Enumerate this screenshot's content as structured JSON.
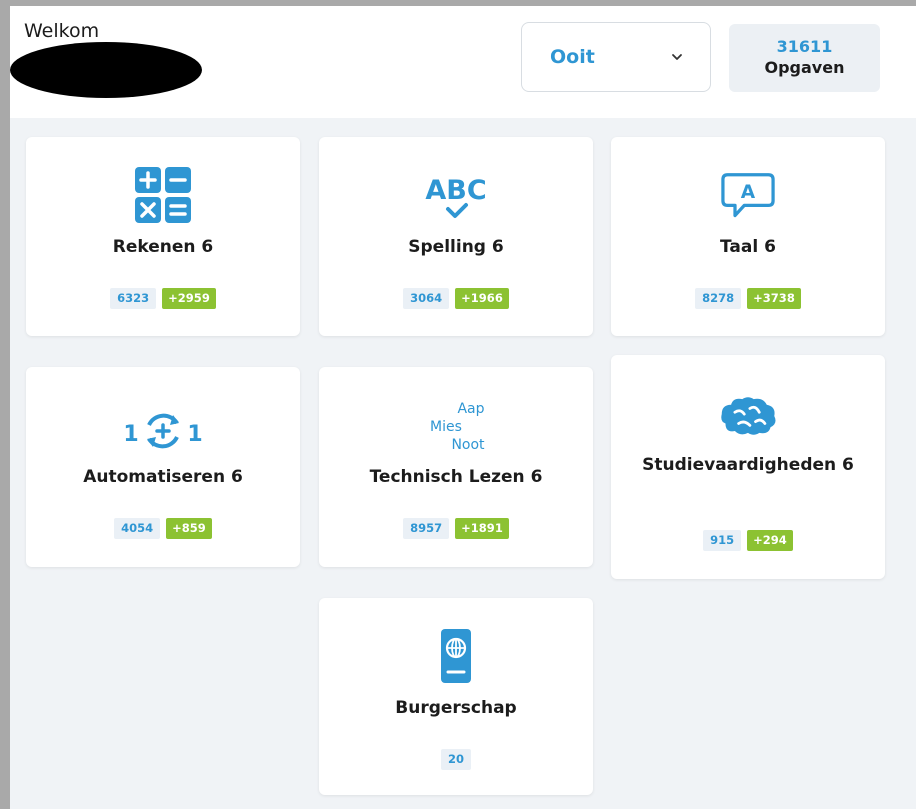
{
  "header": {
    "welcome": "Welkom",
    "period_select": {
      "value": "Ooit"
    },
    "tasks": {
      "count": "31611",
      "label": "Opgaven"
    }
  },
  "colors": {
    "accent": "#2f96d3",
    "plus_badge": "#8cc232",
    "background": "#f0f3f6"
  },
  "subjects": [
    {
      "title": "Rekenen 6",
      "icon": "calculator-icon",
      "total": "6323",
      "plus": "+2959"
    },
    {
      "title": "Spelling 6",
      "icon": "abc-check-icon",
      "total": "3064",
      "plus": "+1966"
    },
    {
      "title": "Taal 6",
      "icon": "speech-bubble-a-icon",
      "total": "8278",
      "plus": "+3738"
    },
    {
      "title": "Automatiseren 6",
      "icon": "one-plus-one-cycle-icon",
      "total": "4054",
      "plus": "+859"
    },
    {
      "title": "Technisch Lezen 6",
      "icon_text": [
        "Aap",
        "Mies",
        "Noot"
      ],
      "icon": "aap-mies-noot-icon",
      "total": "8957",
      "plus": "+1891"
    },
    {
      "title": "Studievaardigheden 6",
      "icon": "brain-icon",
      "total": "915",
      "plus": "+294"
    },
    {
      "title": "Burgerschap",
      "icon": "passport-icon",
      "total": "20"
    }
  ]
}
